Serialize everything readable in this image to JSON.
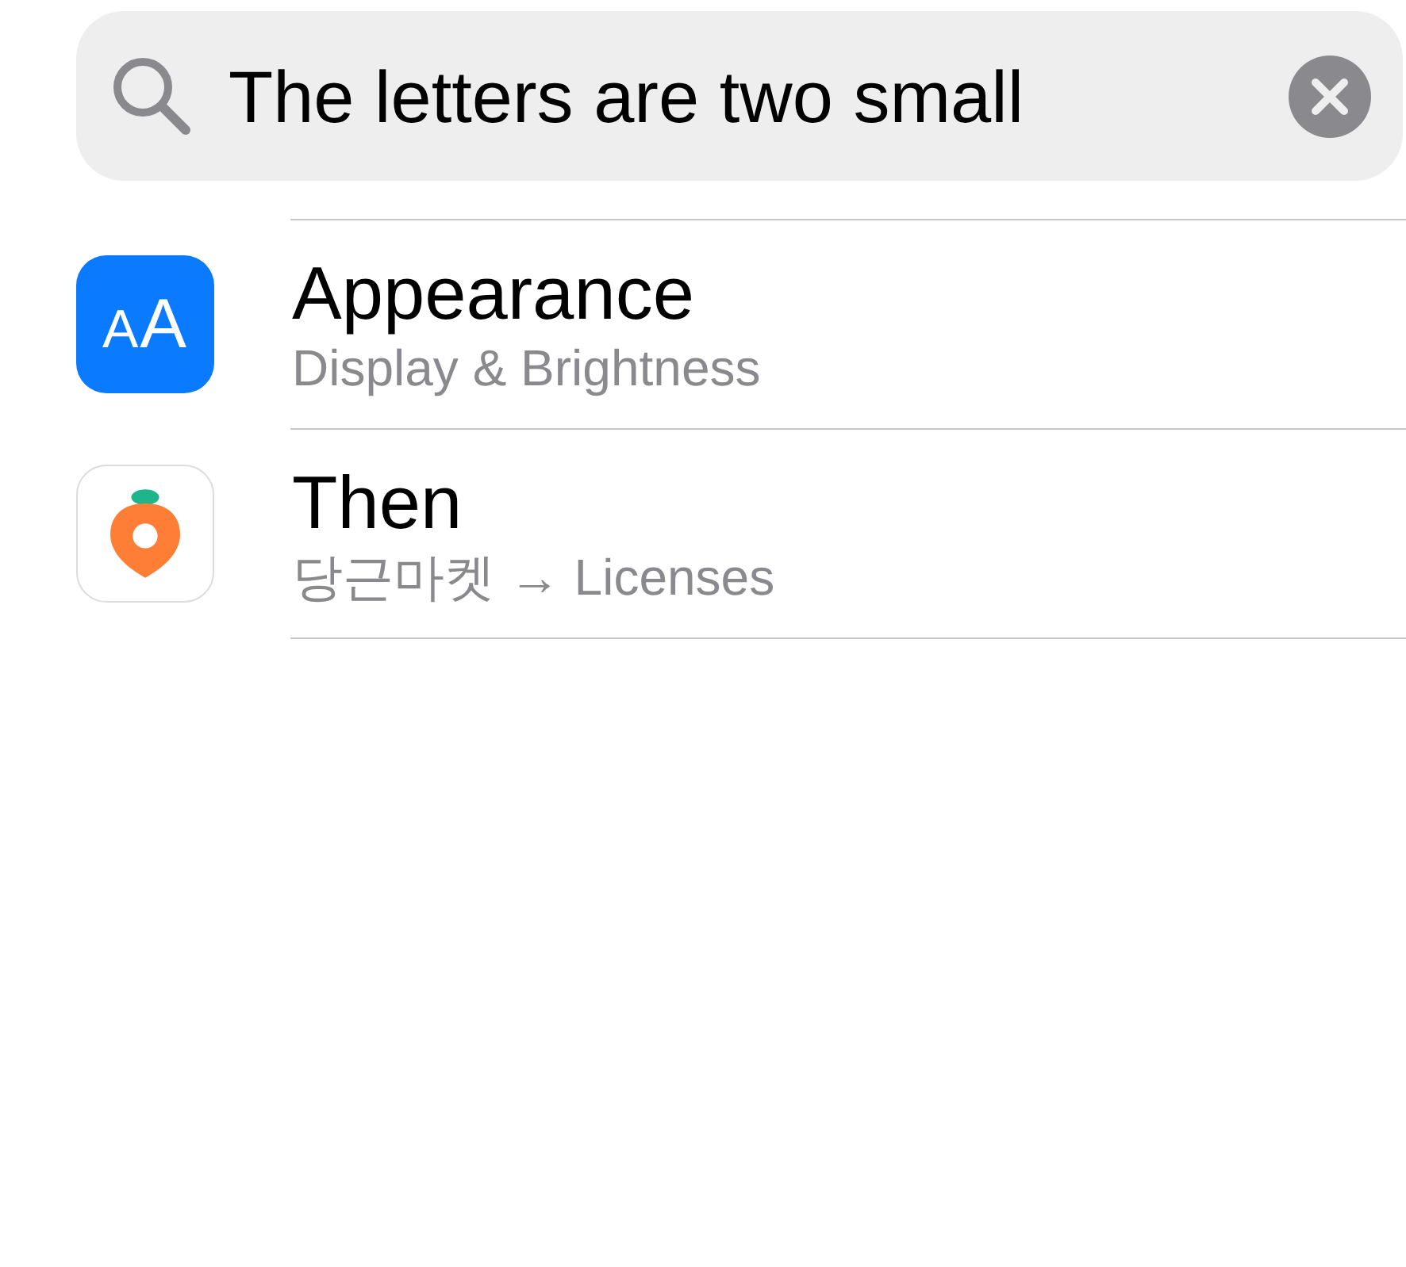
{
  "search": {
    "value": "The letters are two small"
  },
  "results": [
    {
      "kind": "glyph",
      "icon_text": "AA",
      "title": "Appearance",
      "subtitle": "Display & Brightness"
    },
    {
      "kind": "carrot",
      "title": "Then",
      "subtitle": "당근마켓 → Licenses"
    }
  ]
}
